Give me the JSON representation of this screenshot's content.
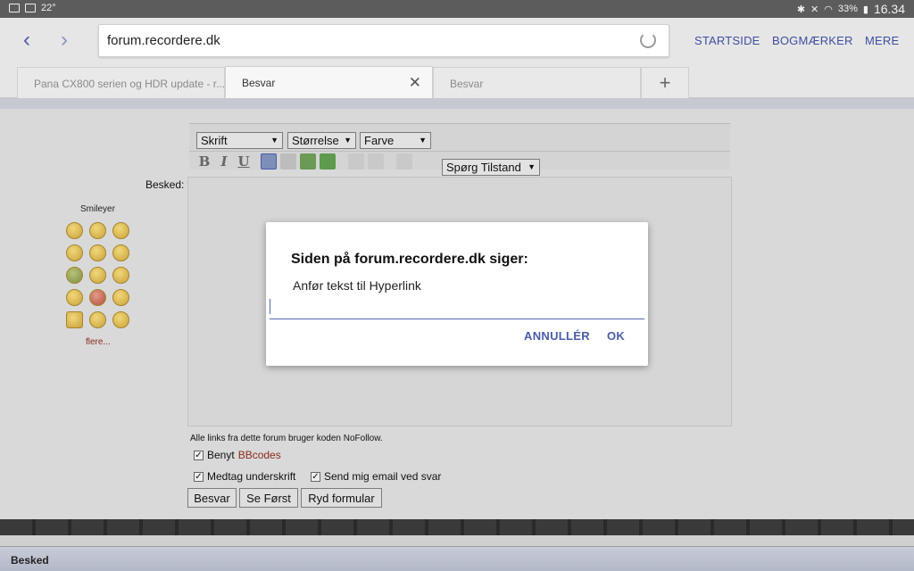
{
  "status_bar": {
    "temperature": "22°",
    "battery": "33%",
    "clock": "16.34"
  },
  "browser": {
    "url": "forum.recordere.dk",
    "menu": {
      "startside": "STARTSIDE",
      "bogmaerker": "BOGMÆRKER",
      "mere": "MERE"
    },
    "tabs": [
      {
        "label": "Pana CX800 serien og HDR update - r..."
      },
      {
        "label": "Besvar"
      },
      {
        "label": "Besvar"
      }
    ],
    "new_tab": "+"
  },
  "editor": {
    "font_select": "Skrift",
    "size_select": "Størrelse",
    "color_select": "Farve",
    "ask_select": "Spørg Tilstand",
    "bold": "B",
    "italic": "I",
    "underline": "U"
  },
  "form": {
    "message_label": "Besked:",
    "smileys_title": "Smileyer",
    "more_smileys": "flere...",
    "nofollow_note": "Alle links fra dette forum bruger koden NoFollow.",
    "use_prefix": "Benyt",
    "bbcodes": "BBcodes",
    "include_signature": "Medtag underskrift",
    "send_email": "Send mig email ved svar",
    "btn_reply": "Besvar",
    "btn_preview": "Se Først",
    "btn_clear": "Ryd formular"
  },
  "bottom_bar": {
    "label": "Besked"
  },
  "dialog": {
    "title": "Siden på forum.recordere.dk siger:",
    "message": "Anfør tekst til Hyperlink",
    "input_value": "",
    "cancel": "ANNULLÉR",
    "ok": "OK"
  },
  "colors": {
    "accent": "#4a5ca8",
    "link_red": "#8b2a1e"
  }
}
